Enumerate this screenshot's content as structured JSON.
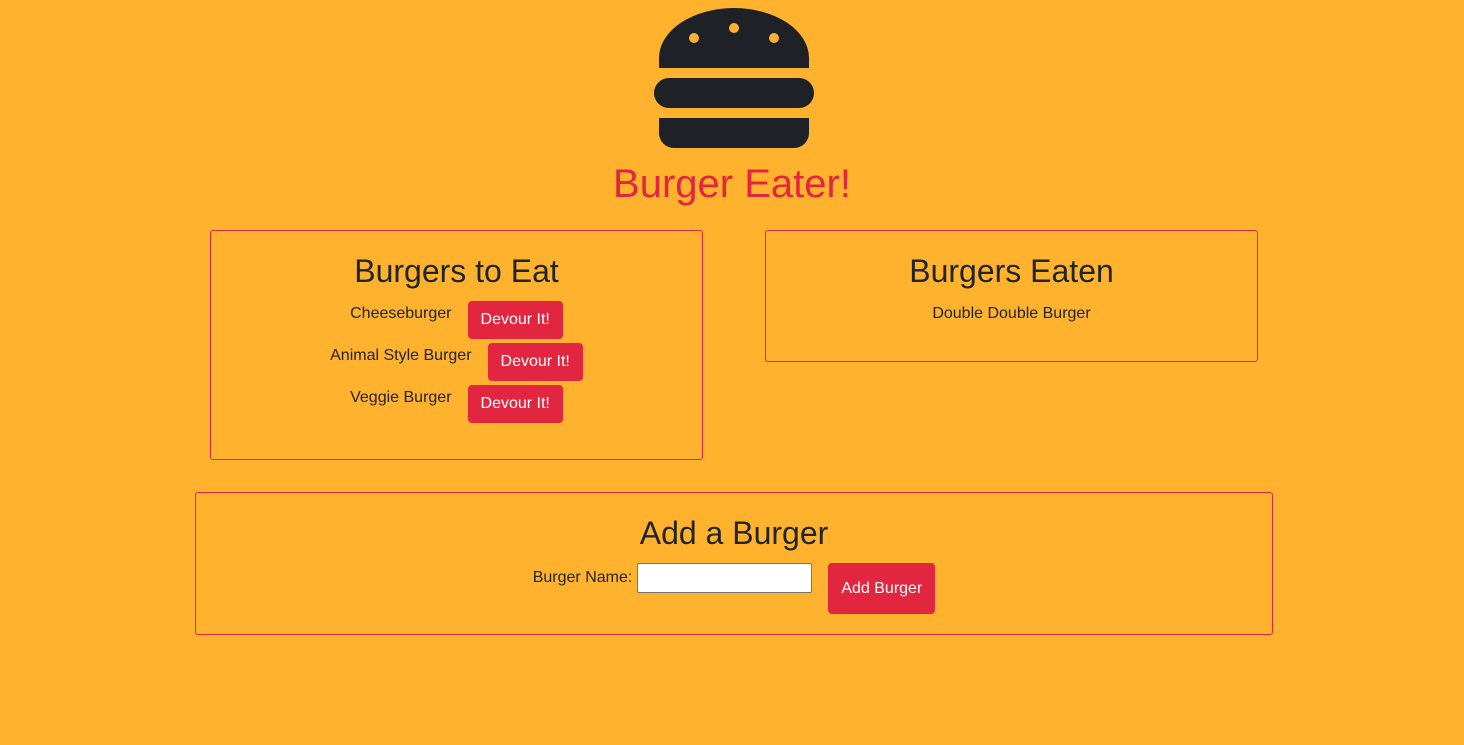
{
  "header": {
    "logo_icon": "burger-icon",
    "title": "Burger Eater!",
    "title_color": "#e3263f"
  },
  "to_eat": {
    "heading": "Burgers to Eat",
    "items": [
      {
        "name": "Cheeseburger",
        "button_label": "Devour It!"
      },
      {
        "name": "Animal Style Burger",
        "button_label": "Devour It!"
      },
      {
        "name": "Veggie Burger",
        "button_label": "Devour It!"
      }
    ]
  },
  "eaten": {
    "heading": "Burgers Eaten",
    "items": [
      {
        "name": "Double Double Burger"
      }
    ]
  },
  "add_form": {
    "heading": "Add a Burger",
    "field_label": "Burger Name:",
    "input_value": "",
    "input_placeholder": "",
    "submit_label": "Add Burger"
  },
  "colors": {
    "background": "#ffb22d",
    "accent": "#e3263f",
    "text": "#212529",
    "logo": "#1e2125"
  }
}
